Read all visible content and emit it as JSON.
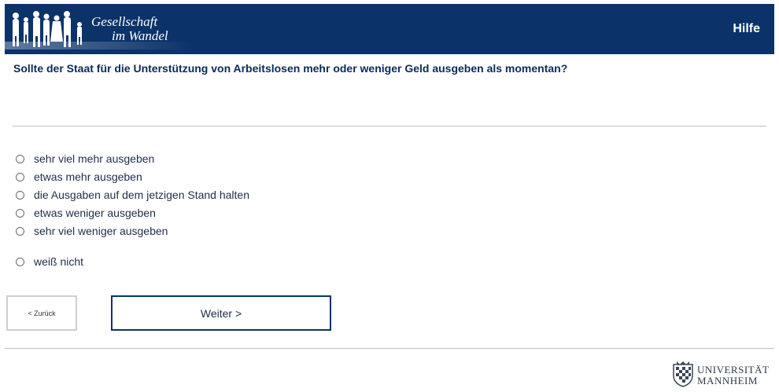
{
  "header": {
    "logo_line1": "Gesellschaft",
    "logo_line2": "im Wandel",
    "help_label": "Hilfe"
  },
  "question": {
    "text": "Sollte der Staat für die Unterstützung von Arbeitslosen mehr oder weniger Geld ausgeben als momentan?"
  },
  "options": [
    {
      "label": "sehr viel mehr ausgeben",
      "selected": false
    },
    {
      "label": "etwas mehr ausgeben",
      "selected": false
    },
    {
      "label": "die Ausgaben auf dem jetzigen Stand halten",
      "selected": false
    },
    {
      "label": "etwas weniger ausgeben",
      "selected": false
    },
    {
      "label": "sehr viel weniger ausgeben",
      "selected": false
    },
    {
      "label": "weiß nicht",
      "selected": false
    }
  ],
  "navigation": {
    "back_label": "< Zurück",
    "next_label": "Weiter >"
  },
  "footer": {
    "university_line1": "UNIVERSITÄT",
    "university_line2": "MANNHEIM"
  },
  "colors": {
    "header_bg": "#0b3369",
    "accent": "#0b3369",
    "text": "#1a2b48"
  }
}
